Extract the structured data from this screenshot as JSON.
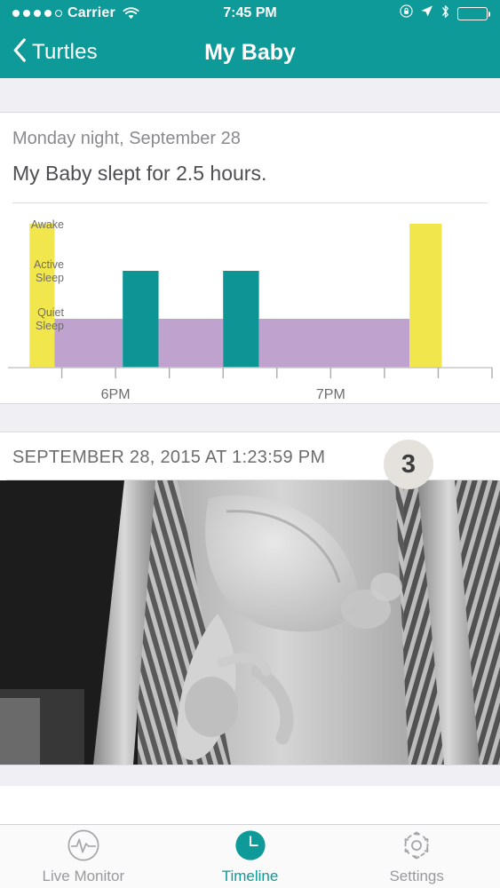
{
  "status_bar": {
    "carrier": "Carrier",
    "signal_dots_filled": 4,
    "signal_dots_total": 5,
    "wifi_icon": "wifi-icon",
    "time": "7:45 PM",
    "icons": [
      "alarm-lock-icon",
      "location-arrow-icon",
      "bluetooth-icon",
      "battery-icon"
    ],
    "battery_percent": 85
  },
  "nav": {
    "back_icon": "chevron-left-icon",
    "back_label": "Turtles",
    "title": "My Baby"
  },
  "sleep_card": {
    "subtitle": "Monday night, September 28",
    "title": "My Baby slept for 2.5 hours."
  },
  "chart_data": {
    "type": "bar",
    "title": "My Baby slept for 2.5 hours.",
    "subtitle": "Monday night, September 28",
    "xlabel": "",
    "ylabel": "",
    "grid": false,
    "legend": "none",
    "y_categories": [
      "Awake",
      "Active Sleep",
      "Quiet Sleep"
    ],
    "y_level_labels": [
      {
        "label": "Awake",
        "line1": "Awake",
        "line2": ""
      },
      {
        "label": "Active Sleep",
        "line1": "Active",
        "line2": "Sleep"
      },
      {
        "label": "Quiet Sleep",
        "line1": "Quiet",
        "line2": "Sleep"
      }
    ],
    "x_tick_labels": [
      "6PM",
      "7PM"
    ],
    "x_tick_count": 9,
    "x_tick_interval_minutes": 15,
    "x_range": [
      "5:30 PM",
      "7:45 PM"
    ],
    "colors": {
      "awake": "#F2E64D",
      "active_sleep": "#0D9596",
      "quiet_sleep": "#C0A2CE",
      "axis": "#C8C8C8",
      "tick": "#ACACAC"
    },
    "segments": [
      {
        "state": "Awake",
        "start": "5:36 PM",
        "end": "5:43 PM",
        "color": "#F2E64D"
      },
      {
        "state": "Quiet Sleep",
        "start": "5:43 PM",
        "end": "6:02 PM",
        "color": "#C0A2CE"
      },
      {
        "state": "Active Sleep",
        "start": "6:02 PM",
        "end": "6:12 PM",
        "color": "#0D9596"
      },
      {
        "state": "Quiet Sleep",
        "start": "6:12 PM",
        "end": "6:30 PM",
        "color": "#C0A2CE"
      },
      {
        "state": "Active Sleep",
        "start": "6:30 PM",
        "end": "6:40 PM",
        "color": "#0D9596"
      },
      {
        "state": "Quiet Sleep",
        "start": "6:40 PM",
        "end": "7:22 PM",
        "color": "#C0A2CE"
      },
      {
        "state": "Awake",
        "start": "7:22 PM",
        "end": "7:31 PM",
        "color": "#F2E64D"
      }
    ]
  },
  "photo_card": {
    "timestamp": "SEPTEMBER 28, 2015 AT 1:23:59 PM",
    "badge_count": "3",
    "image_description": "night-vision-crib-photo"
  },
  "tabbar": {
    "items": [
      {
        "id": "live-monitor",
        "label": "Live Monitor",
        "icon": "waveform-circle-icon",
        "active": false
      },
      {
        "id": "timeline",
        "label": "Timeline",
        "icon": "clock-icon",
        "active": true
      },
      {
        "id": "settings",
        "label": "Settings",
        "icon": "gear-icon",
        "active": false
      }
    ],
    "active_color": "#0D9A98",
    "inactive_color": "#9A9A9E"
  }
}
